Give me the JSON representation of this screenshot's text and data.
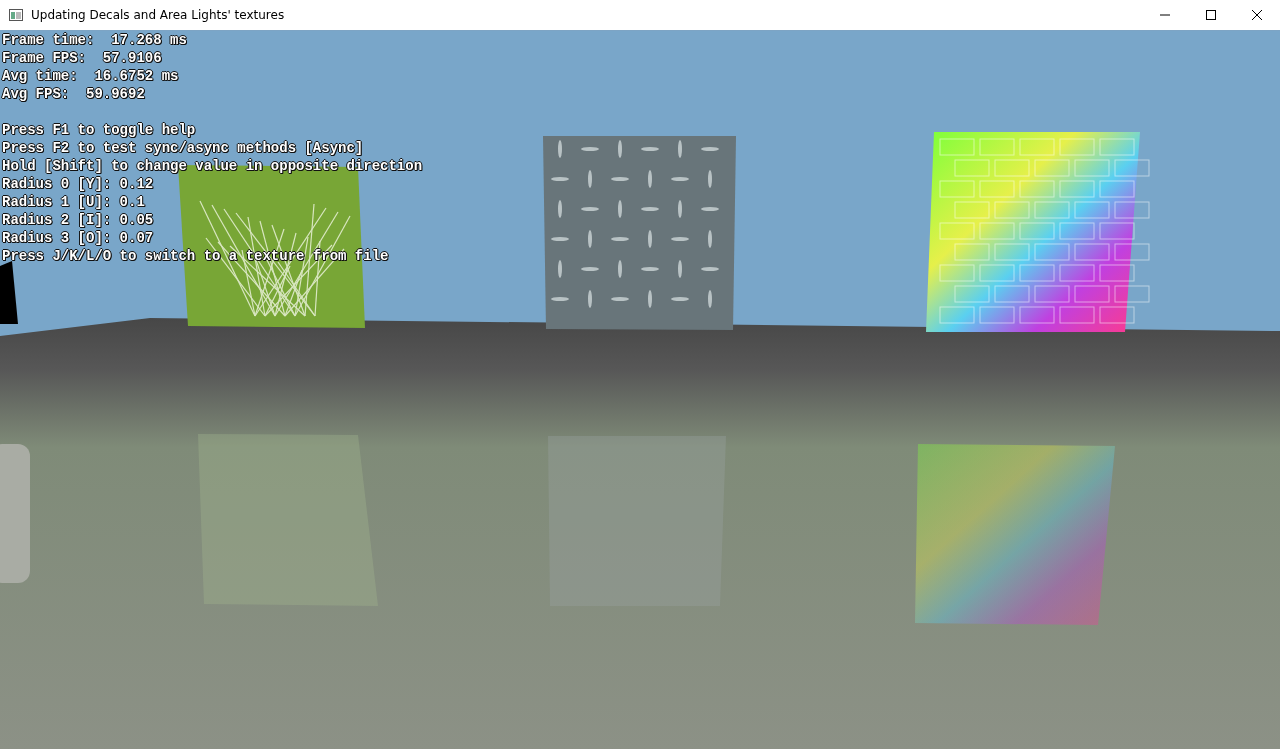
{
  "window": {
    "title": "Updating Decals and Area Lights' textures"
  },
  "overlay": {
    "stats": [
      "Frame time:  17.268 ms",
      "Frame FPS:  57.9106",
      "Avg time:  16.6752 ms",
      "Avg FPS:  59.9692"
    ],
    "help": [
      "Press F1 to toggle help",
      "Press F2 to test sync/async methods [Async]",
      "Hold [Shift] to change value in opposite direction",
      "Radius 0 [Y]: 0.12",
      "Radius 1 [U]: 0.1",
      "Radius 2 [I]: 0.05",
      "Radius 3 [O]: 0.07",
      "Press J/K/L/O to switch to a texture from file"
    ]
  }
}
